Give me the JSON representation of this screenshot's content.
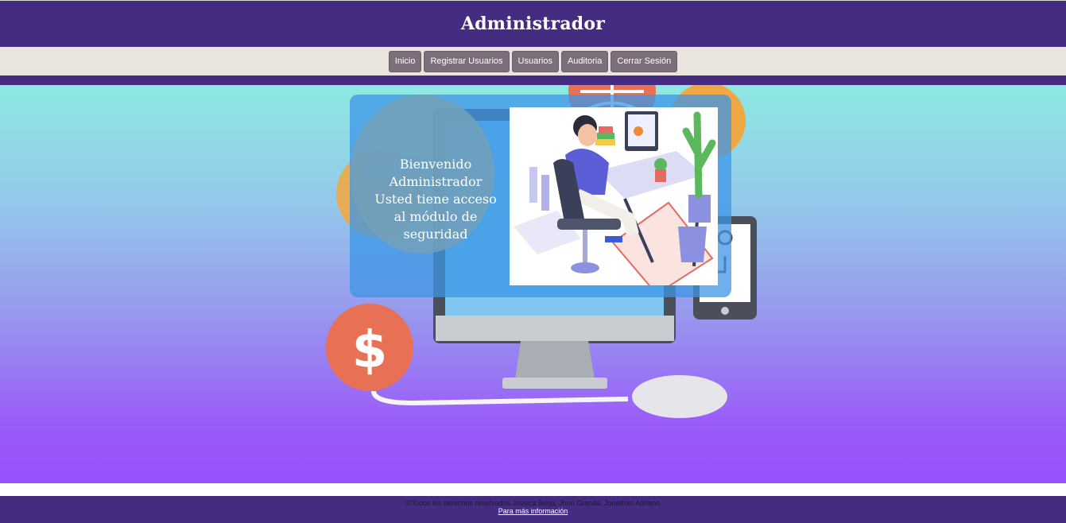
{
  "header": {
    "title": "Administrador"
  },
  "nav": {
    "items": [
      {
        "label": "Inicio"
      },
      {
        "label": "Registrar Usuarios"
      },
      {
        "label": "Usuarios"
      },
      {
        "label": "Auditoria"
      },
      {
        "label": "Cerrar Sesión"
      }
    ]
  },
  "welcome": {
    "line1": "Bienvenido",
    "line2": "Administrador",
    "line3": "Usted tiene acceso",
    "line4": "al módulo de",
    "line5": "seguridad"
  },
  "footer": {
    "copyright": "©Todos los derechos reservados Jessica Borja, Jhon Granda, Jonathan Adriano",
    "link": "Para más información"
  },
  "colors": {
    "header_bg": "#452c80",
    "nav_bg": "#e9e4de",
    "nav_button": "#7d6e7b"
  }
}
